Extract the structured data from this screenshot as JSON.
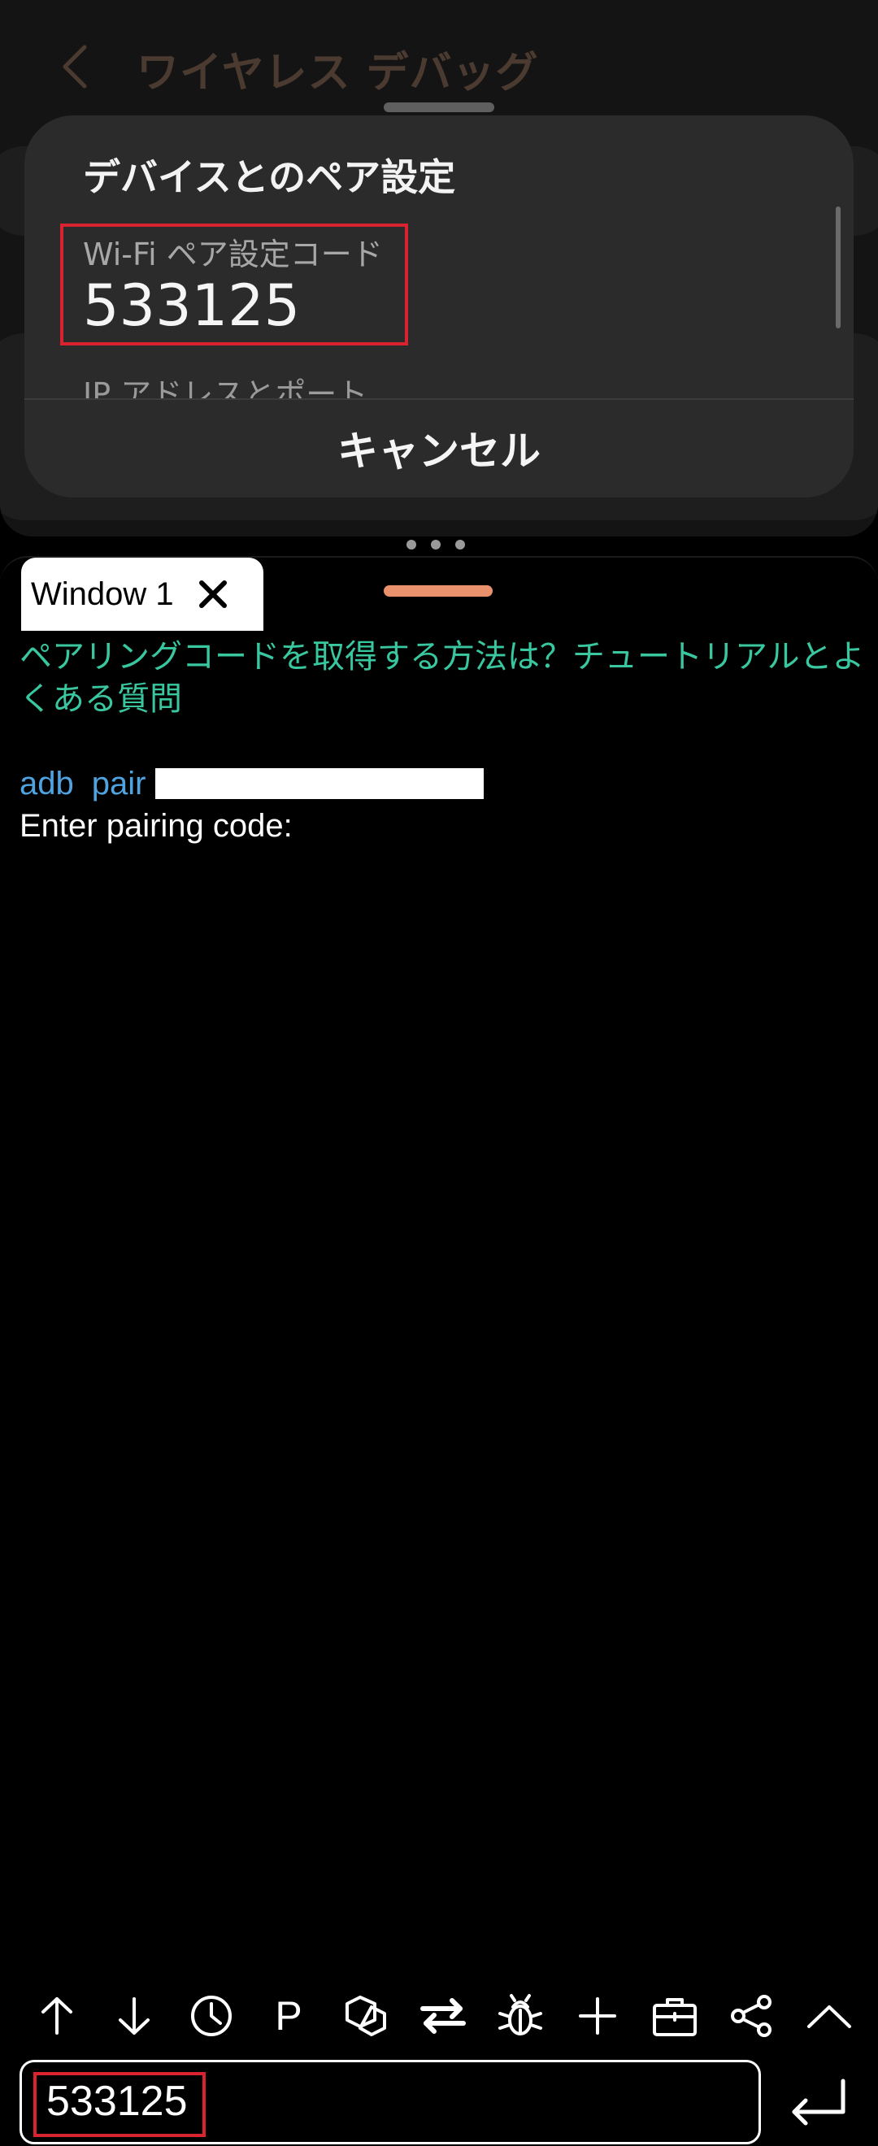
{
  "background_app": {
    "title": "ワイヤレス デバッグ"
  },
  "pair_dialog": {
    "title": "デバイスとのペア設定",
    "wifi_code_label": "Wi-Fi ペア設定コード",
    "wifi_code_value": "533125",
    "ip_label": "IP アドレスとポート",
    "cancel_label": "キャンセル"
  },
  "terminal": {
    "tab_label": "Window 1",
    "help_link": "ペアリングコードを取得する方法は？チュートリアルとよくある質問",
    "cmd_adb": "adb",
    "cmd_pair": "pair",
    "prompt": "Enter pairing code:",
    "toolbar": {
      "p_label": "P",
      "icons": [
        "arrow-up-icon",
        "arrow-down-icon",
        "clock-icon",
        "p-icon",
        "hexagon-icon",
        "swap-icon",
        "bug-icon",
        "plus-icon",
        "briefcase-icon",
        "share-icon",
        "chevron-up-icon"
      ]
    },
    "input_value": "533125"
  },
  "colors": {
    "accent_link": "#39c7a0",
    "command_blue": "#4fa3e0",
    "handle_orange": "#e9916d",
    "highlight_red": "#d9232e"
  }
}
